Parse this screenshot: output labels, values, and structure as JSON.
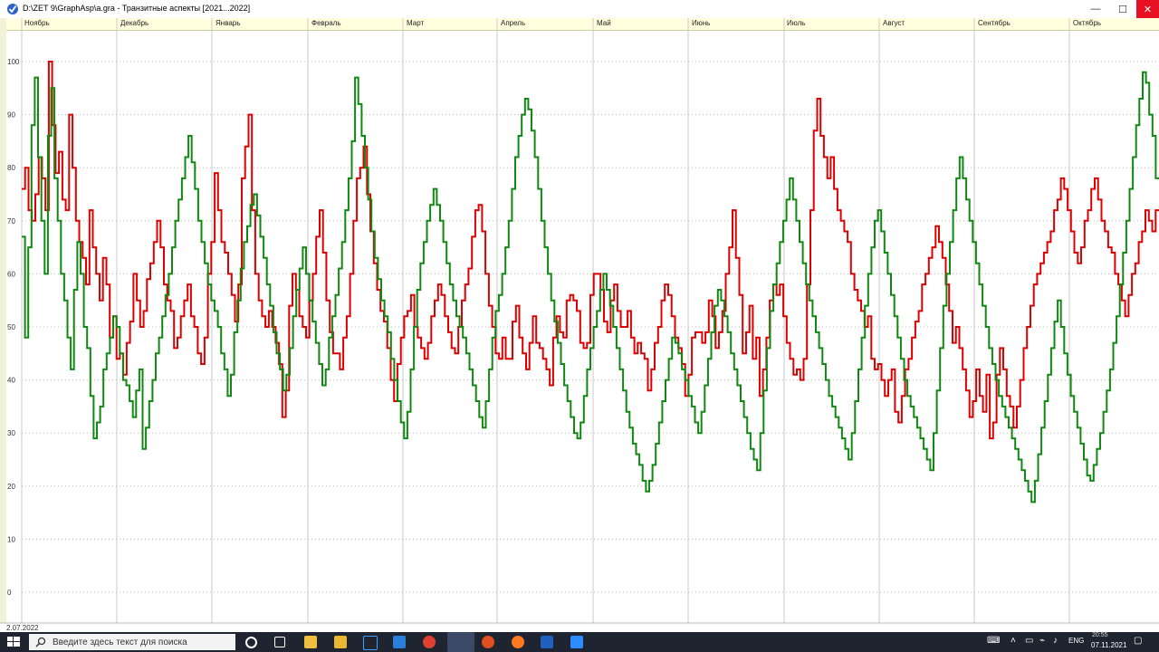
{
  "window": {
    "title": "D:\\ZET 9\\GraphAsp\\a.gra - Транзитные аспекты [2021...2022]",
    "minimize": "—",
    "maximize": "☐",
    "close": "✕"
  },
  "start_date": "2.07.2022",
  "chart_data": {
    "type": "line",
    "months": [
      "Ноябрь",
      "Декабрь",
      "Январь",
      "Февраль",
      "Март",
      "Апрель",
      "Май",
      "Июнь",
      "Июль",
      "Август",
      "Сентябрь",
      "Октябрь"
    ],
    "y_ticks": [
      0,
      10,
      20,
      30,
      40,
      50,
      60,
      70,
      80,
      90,
      100
    ],
    "ylim": [
      0,
      100
    ],
    "grid": true,
    "series": [
      {
        "color": "#dd0000",
        "values": [
          76,
          80,
          72,
          70,
          75,
          82,
          78,
          72,
          100,
          88,
          79,
          83,
          74,
          72,
          90,
          80,
          70,
          66,
          63,
          58,
          72,
          65,
          60,
          55,
          63,
          58,
          48,
          52,
          44,
          45,
          41,
          47,
          51,
          60,
          55,
          50,
          53,
          59,
          62,
          66,
          70,
          65,
          58,
          55,
          53,
          46,
          48,
          52,
          55,
          58,
          52,
          50,
          45,
          43,
          48,
          60,
          66,
          79,
          72,
          66,
          64,
          60,
          56,
          51,
          58,
          78,
          84,
          90,
          72,
          60,
          55,
          52,
          50,
          53,
          50,
          47,
          43,
          33,
          38,
          54,
          60,
          57,
          52,
          50,
          48,
          55,
          60,
          67,
          72,
          64,
          55,
          49,
          45,
          45,
          42,
          48,
          52,
          60,
          70,
          78,
          80,
          84,
          75,
          68,
          62,
          57,
          53,
          51,
          46,
          40,
          36,
          43,
          48,
          52,
          53,
          56,
          50,
          48,
          46,
          44,
          47,
          52,
          55,
          58,
          56,
          52,
          49,
          46,
          45,
          50,
          55,
          58,
          61,
          67,
          72,
          73,
          68,
          60,
          54,
          50,
          45,
          44,
          48,
          44,
          44,
          51,
          54,
          48,
          45,
          42,
          47,
          52,
          47,
          46,
          44,
          42,
          39,
          48,
          52,
          49,
          48,
          55,
          56,
          55,
          53,
          47,
          46,
          47,
          56,
          60,
          60,
          57,
          51,
          49,
          55,
          58,
          53,
          50,
          50,
          53,
          48,
          45,
          47,
          45,
          44,
          38,
          42,
          47,
          50,
          55,
          58,
          56,
          52,
          48,
          46,
          43,
          37,
          41,
          48,
          49,
          49,
          47,
          49,
          55,
          52,
          46,
          49,
          53,
          60,
          65,
          72,
          63,
          56,
          45,
          49,
          54,
          44,
          48,
          37,
          42,
          48,
          55,
          58,
          56,
          58,
          52,
          47,
          44,
          41,
          42,
          40,
          44,
          58,
          72,
          87,
          93,
          86,
          82,
          78,
          82,
          76,
          72,
          70,
          68,
          66,
          60,
          57,
          55,
          53,
          50,
          52,
          44,
          42,
          43,
          40,
          37,
          40,
          42,
          34,
          32,
          37,
          42,
          44,
          48,
          51,
          53,
          58,
          60,
          63,
          65,
          69,
          66,
          63,
          58,
          53,
          47,
          50,
          46,
          42,
          38,
          33,
          36,
          42,
          37,
          34,
          41,
          29,
          32,
          41,
          46,
          42,
          37,
          35,
          31,
          35,
          40,
          46,
          50,
          54,
          58,
          60,
          62,
          64,
          66,
          68,
          72,
          74,
          78,
          76,
          72,
          68,
          64,
          62,
          65,
          70,
          72,
          76,
          78,
          74,
          70,
          68,
          65,
          64,
          60,
          58,
          55,
          52,
          56,
          60,
          62,
          66,
          68,
          72,
          70,
          68,
          72
        ]
      },
      {
        "color": "#118811",
        "values": [
          67,
          48,
          65,
          88,
          97,
          82,
          70,
          60,
          86,
          95,
          78,
          70,
          60,
          55,
          48,
          42,
          57,
          66,
          60,
          50,
          46,
          37,
          29,
          32,
          35,
          42,
          45,
          48,
          52,
          50,
          45,
          40,
          39,
          36,
          33,
          38,
          42,
          27,
          31,
          36,
          40,
          45,
          48,
          52,
          56,
          60,
          65,
          70,
          74,
          78,
          82,
          86,
          81,
          76,
          70,
          66,
          62,
          58,
          55,
          53,
          50,
          45,
          42,
          37,
          41,
          49,
          55,
          61,
          66,
          69,
          73,
          75,
          71,
          67,
          63,
          58,
          54,
          49,
          45,
          42,
          38,
          41,
          46,
          52,
          57,
          61,
          65,
          60,
          55,
          51,
          47,
          43,
          39,
          42,
          48,
          52,
          56,
          61,
          66,
          72,
          78,
          85,
          97,
          92,
          86,
          80,
          74,
          68,
          63,
          59,
          55,
          52,
          49,
          44,
          40,
          36,
          32,
          29,
          34,
          42,
          50,
          57,
          62,
          66,
          70,
          73,
          76,
          73,
          70,
          66,
          62,
          58,
          55,
          52,
          50,
          48,
          45,
          42,
          39,
          36,
          33,
          31,
          36,
          42,
          48,
          53,
          56,
          60,
          65,
          70,
          76,
          82,
          86,
          90,
          93,
          91,
          87,
          82,
          76,
          70,
          65,
          60,
          55,
          51,
          47,
          43,
          39,
          36,
          33,
          30,
          29,
          32,
          37,
          42,
          46,
          50,
          53,
          57,
          60,
          57,
          54,
          50,
          46,
          42,
          38,
          34,
          31,
          28,
          26,
          24,
          21,
          19,
          21,
          24,
          28,
          32,
          36,
          40,
          44,
          48,
          47,
          45,
          42,
          40,
          37,
          35,
          32,
          30,
          34,
          39,
          44,
          49,
          54,
          57,
          55,
          52,
          49,
          45,
          42,
          39,
          36,
          33,
          30,
          27,
          25,
          23,
          30,
          38,
          46,
          53,
          58,
          62,
          66,
          70,
          74,
          78,
          74,
          70,
          66,
          62,
          58,
          55,
          52,
          49,
          46,
          43,
          40,
          37,
          35,
          33,
          31,
          29,
          27,
          25,
          30,
          36,
          42,
          48,
          54,
          60,
          65,
          70,
          72,
          68,
          64,
          60,
          56,
          52,
          48,
          44,
          40,
          37,
          35,
          33,
          31,
          29,
          27,
          25,
          23,
          30,
          38,
          46,
          54,
          60,
          66,
          72,
          78,
          82,
          78,
          74,
          70,
          66,
          62,
          58,
          54,
          50,
          46,
          43,
          40,
          37,
          35,
          33,
          31,
          29,
          27,
          25,
          23,
          21,
          19,
          17,
          21,
          26,
          31,
          36,
          41,
          46,
          51,
          55,
          50,
          45,
          41,
          37,
          34,
          31,
          28,
          25,
          22,
          21,
          24,
          27,
          30,
          34,
          38,
          42,
          47,
          52,
          58,
          64,
          70,
          76,
          82,
          88,
          93,
          98,
          96,
          90,
          86,
          78
        ]
      }
    ]
  },
  "taskbar": {
    "search_placeholder": "Введите здесь текст для поиска",
    "tray_lang": "ENG",
    "tray_time": "20:55",
    "tray_date": "07.11.2021"
  }
}
